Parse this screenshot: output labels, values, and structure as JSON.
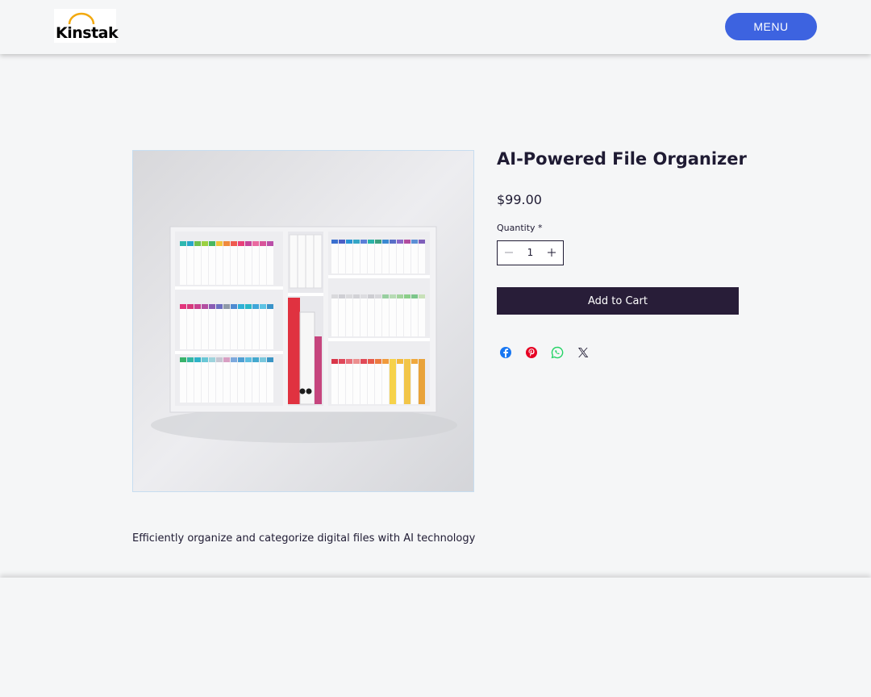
{
  "header": {
    "logo_text": "Kinstak",
    "menu_label": "MENU",
    "menu_color": "#3d63e0"
  },
  "product": {
    "image_icon": "file-organizer-shelf-image",
    "title": "AI-Powered File Organizer",
    "price": "$99.00",
    "quantity_label": "Quantity *",
    "quantity_value": "1",
    "add_to_cart_label": "Add to Cart",
    "description": "Efficiently organize and categorize digital files with AI technology"
  },
  "share": [
    {
      "icon": "facebook-icon",
      "color": "#1877f2"
    },
    {
      "icon": "pinterest-icon",
      "color": "#e60023"
    },
    {
      "icon": "whatsapp-icon",
      "color": "#25d366"
    },
    {
      "icon": "x-icon",
      "color": "#1f1b33"
    }
  ],
  "colors": {
    "background": "#f5f6f7",
    "text": "#1f1b33",
    "cart_button": "#281d38"
  }
}
